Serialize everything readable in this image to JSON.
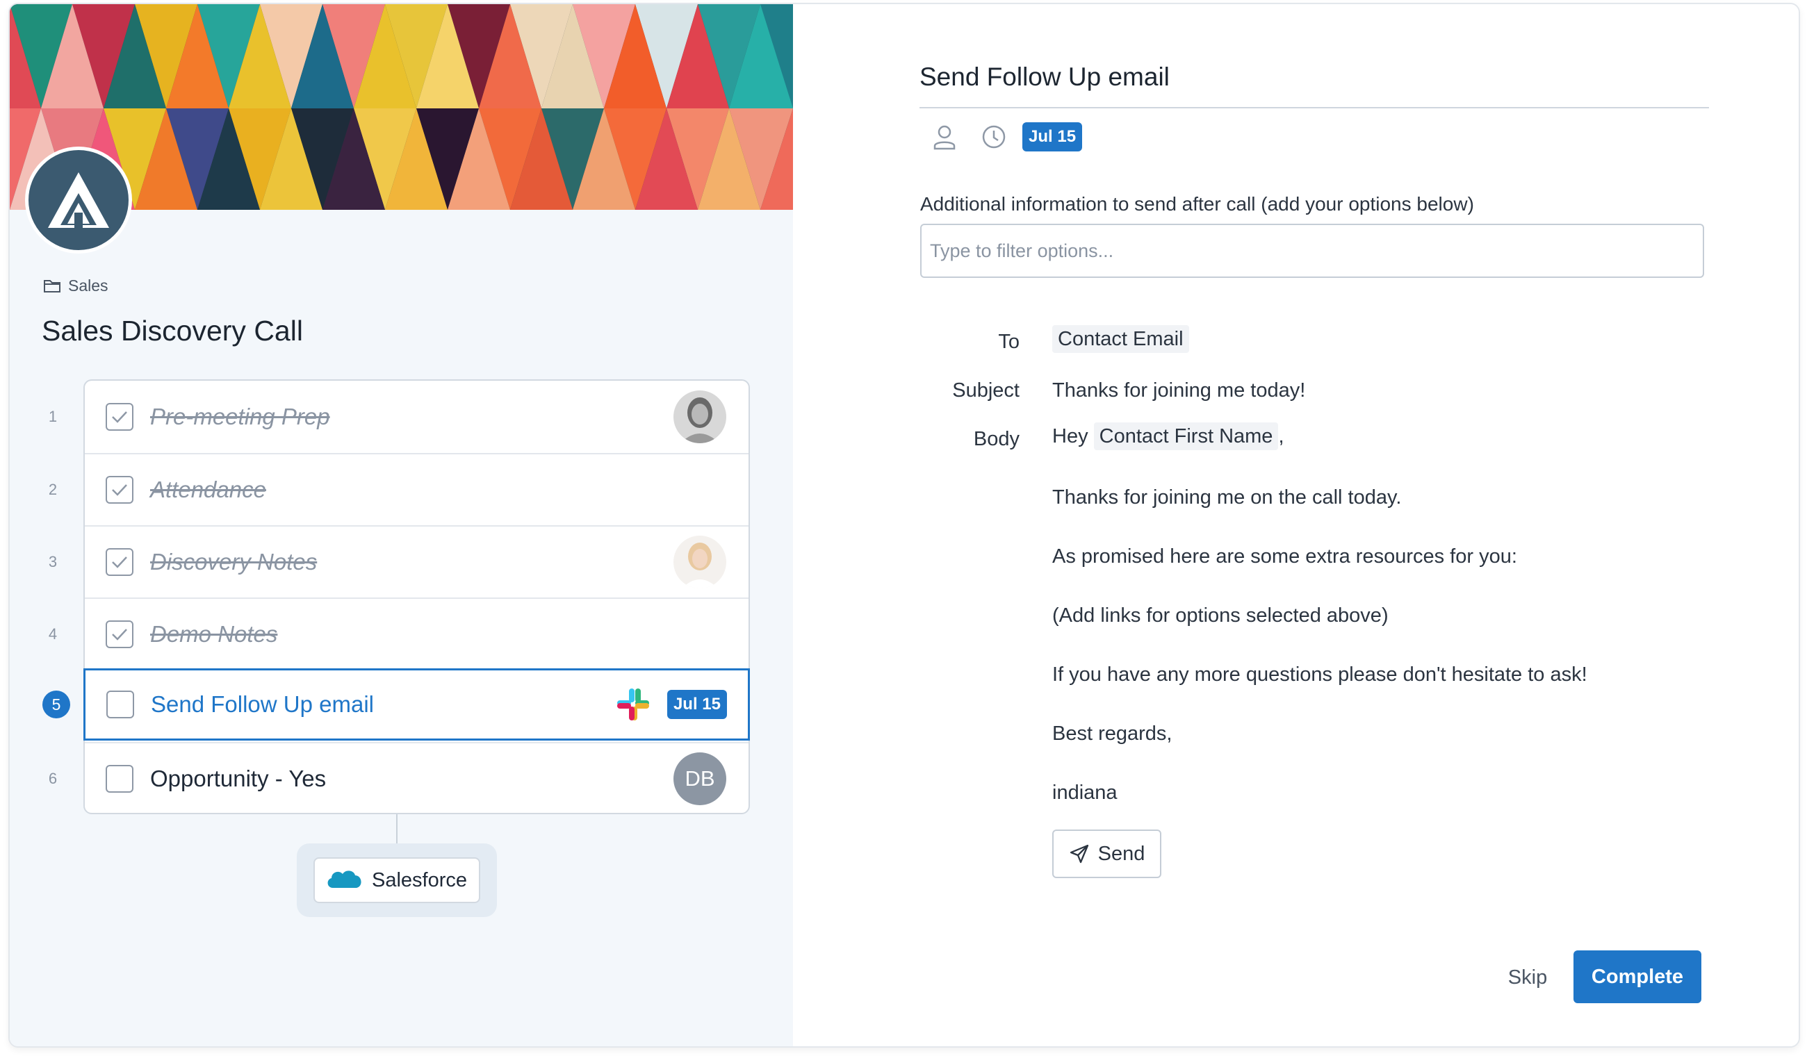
{
  "colors": {
    "accent": "#1f76c8",
    "left_panel_bg": "#f3f7fb",
    "avatar_gray": "#8c96a3"
  },
  "workflow": {
    "folder_icon": "folder-icon",
    "folder": "Sales",
    "title": "Sales Discovery Call",
    "steps": [
      {
        "number": "1",
        "label": "Pre-meeting Prep",
        "done": true,
        "assignee": "person-photo"
      },
      {
        "number": "2",
        "label": "Attendance",
        "done": true
      },
      {
        "number": "3",
        "label": "Discovery Notes",
        "done": true,
        "assignee": "person-photo"
      },
      {
        "number": "4",
        "label": "Demo Notes",
        "done": true
      },
      {
        "number": "5",
        "label": "Send Follow Up email",
        "done": false,
        "active": true,
        "integration": "slack-icon",
        "due": "Jul 15"
      },
      {
        "number": "6",
        "label": "Opportunity - Yes",
        "done": false,
        "assignee_initials": "DB"
      }
    ],
    "integration_chip": {
      "icon": "salesforce-icon",
      "label": "Salesforce"
    }
  },
  "task": {
    "title": "Send Follow Up email",
    "assignee_icon": "user-icon",
    "due_icon": "clock-icon",
    "due_date": "Jul 15",
    "field_label": "Additional information to send after call (add your options below)",
    "filter_placeholder": "Type to filter options...",
    "email": {
      "to_label": "To",
      "to_value": "Contact Email",
      "subject_label": "Subject",
      "subject_value": "Thanks for joining me today!",
      "body_label": "Body",
      "greeting_prefix": "Hey",
      "greeting_token": "Contact First Name",
      "greeting_suffix": ",",
      "lines": [
        "Thanks for joining me on the call today.",
        "As promised here are some extra resources for you:",
        "(Add links for options selected above)",
        "If you have any more questions please don't hesitate to ask!",
        "Best regards,",
        "indiana"
      ]
    },
    "send_label": "Send",
    "skip_label": "Skip",
    "complete_label": "Complete"
  }
}
